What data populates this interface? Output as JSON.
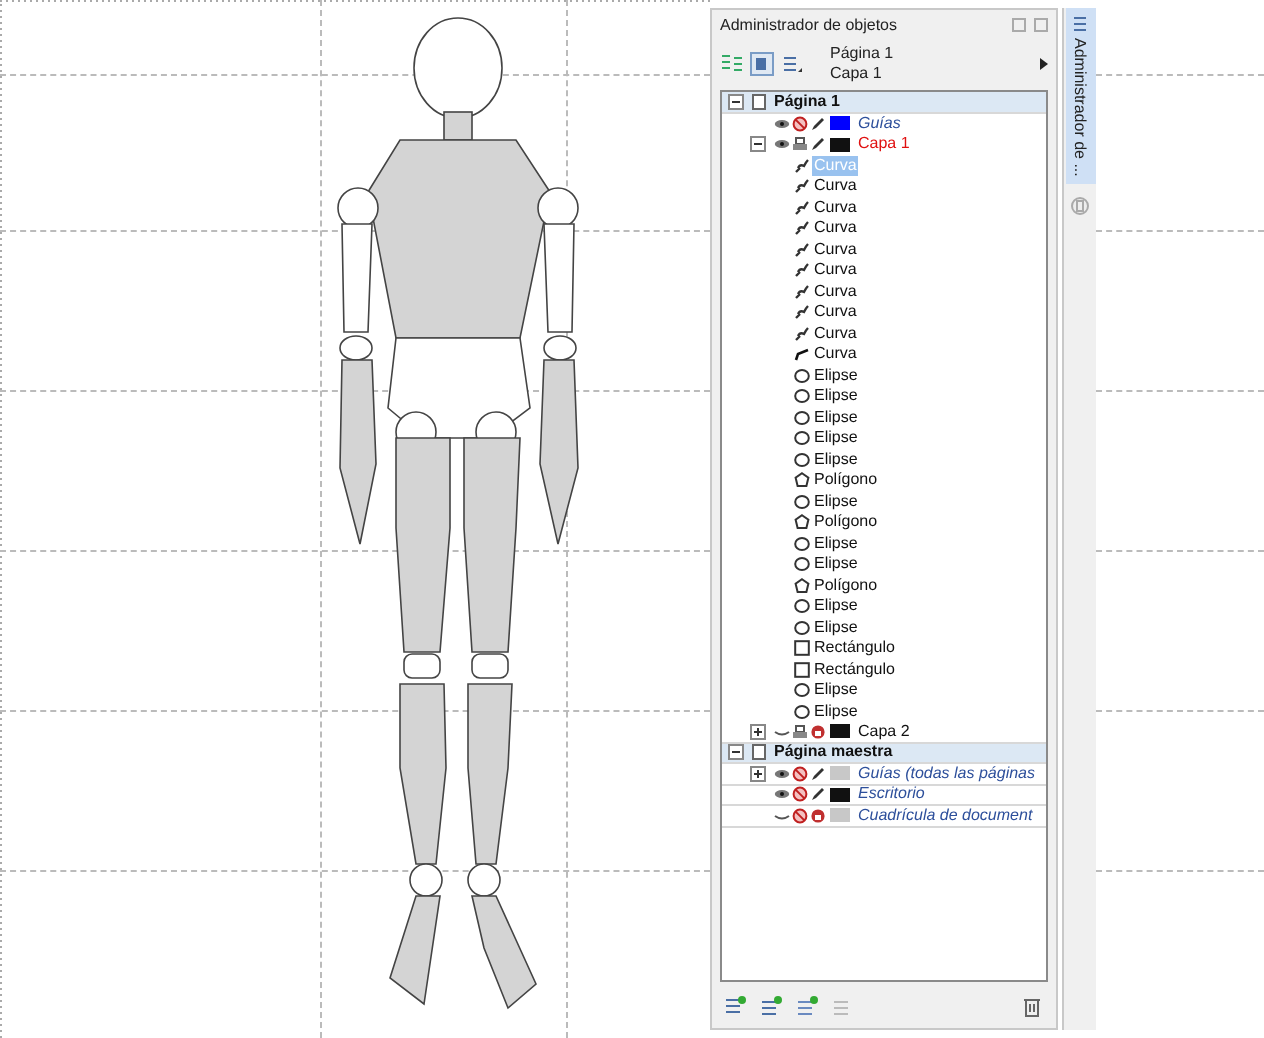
{
  "panel": {
    "title": "Administrador de objetos",
    "current_page": "Página 1",
    "current_layer": "Capa 1",
    "side_tab": "Administrador de ..."
  },
  "tree": [
    {
      "label": "Página 1",
      "kind": "page",
      "expanded": true,
      "children": [
        {
          "label": "Guías",
          "kind": "layer",
          "special": true,
          "active": false,
          "visible": true,
          "printable": false,
          "editable": true,
          "color": "#0000ff"
        },
        {
          "label": "Capa 1",
          "kind": "layer",
          "special": false,
          "active": true,
          "expanded": true,
          "visible": true,
          "printable": true,
          "editable": true,
          "color": "#111111",
          "children": [
            {
              "label": "Curva",
              "kind": "curve",
              "selected": true
            },
            {
              "label": "Curva",
              "kind": "curve",
              "selected": false
            },
            {
              "label": "Curva",
              "kind": "curve",
              "selected": false
            },
            {
              "label": "Curva",
              "kind": "curve",
              "selected": false
            },
            {
              "label": "Curva",
              "kind": "curve",
              "selected": false
            },
            {
              "label": "Curva",
              "kind": "curve",
              "selected": false
            },
            {
              "label": "Curva",
              "kind": "curve",
              "selected": false
            },
            {
              "label": "Curva",
              "kind": "curve",
              "selected": false
            },
            {
              "label": "Curva",
              "kind": "curve",
              "selected": false
            },
            {
              "label": "Curva",
              "kind": "line",
              "selected": false
            },
            {
              "label": "Elipse",
              "kind": "ellipse",
              "selected": false
            },
            {
              "label": "Elipse",
              "kind": "ellipse",
              "selected": false
            },
            {
              "label": "Elipse",
              "kind": "ellipse",
              "selected": false
            },
            {
              "label": "Elipse",
              "kind": "ellipse",
              "selected": false
            },
            {
              "label": "Elipse",
              "kind": "ellipse",
              "selected": false
            },
            {
              "label": "Polígono",
              "kind": "polygon",
              "selected": false
            },
            {
              "label": "Elipse",
              "kind": "ellipse",
              "selected": false
            },
            {
              "label": "Polígono",
              "kind": "polygon",
              "selected": false
            },
            {
              "label": "Elipse",
              "kind": "ellipse",
              "selected": false
            },
            {
              "label": "Elipse",
              "kind": "ellipse",
              "selected": false
            },
            {
              "label": "Polígono",
              "kind": "polygon",
              "selected": false
            },
            {
              "label": "Elipse",
              "kind": "ellipse",
              "selected": false
            },
            {
              "label": "Elipse",
              "kind": "ellipse",
              "selected": false
            },
            {
              "label": "Rectángulo",
              "kind": "rectangle",
              "selected": false
            },
            {
              "label": "Rectángulo",
              "kind": "rectangle",
              "selected": false
            },
            {
              "label": "Elipse",
              "kind": "ellipse",
              "selected": false
            },
            {
              "label": "Elipse",
              "kind": "ellipse",
              "selected": false
            }
          ]
        },
        {
          "label": "Capa 2",
          "kind": "layer",
          "special": false,
          "active": false,
          "expanded": false,
          "visible": false,
          "printable": true,
          "editable": false,
          "color": "#111111"
        }
      ]
    },
    {
      "label": "Página maestra",
      "kind": "page",
      "expanded": true,
      "children": [
        {
          "label": "Guías (todas las páginas",
          "kind": "layer",
          "special": true,
          "active": false,
          "expanded": false,
          "visible": true,
          "printable": false,
          "editable": true,
          "color": "#c8c8c8"
        },
        {
          "label": "Escritorio",
          "kind": "layer",
          "special": true,
          "active": false,
          "visible": true,
          "printable": false,
          "editable": true,
          "color": "#111111"
        },
        {
          "label": "Cuadrícula de document",
          "kind": "layer",
          "special": true,
          "active": false,
          "visible": false,
          "printable": false,
          "editable": false,
          "color": "#c8c8c8"
        }
      ]
    }
  ]
}
